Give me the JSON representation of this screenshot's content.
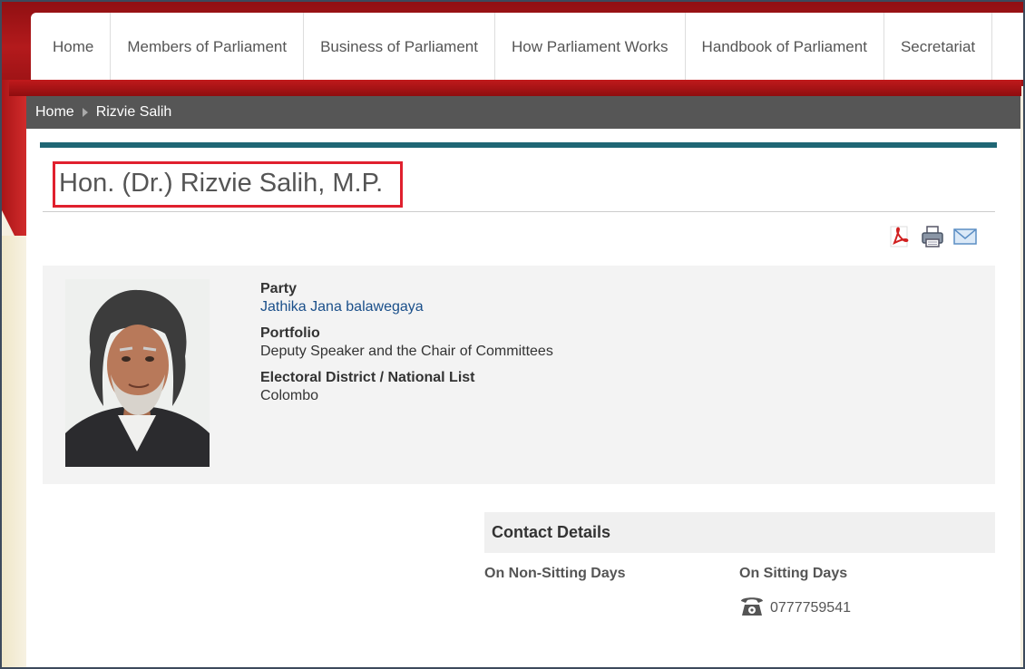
{
  "nav": {
    "items": [
      {
        "label": "Home"
      },
      {
        "label": "Members of Parliament"
      },
      {
        "label": "Business of Parliament"
      },
      {
        "label": "How Parliament Works"
      },
      {
        "label": "Handbook of Parliament"
      },
      {
        "label": "Secretariat"
      }
    ]
  },
  "breadcrumb": {
    "home": "Home",
    "current": "Rizvie Salih"
  },
  "page": {
    "title": "Hon. (Dr.) Rizvie Salih, M.P."
  },
  "tools": [
    {
      "icon": "pdf-icon"
    },
    {
      "icon": "print-icon"
    },
    {
      "icon": "email-icon"
    }
  ],
  "profile": {
    "party_label": "Party",
    "party_value": "Jathika Jana balawegaya",
    "portfolio_label": "Portfolio",
    "portfolio_value": "Deputy Speaker and the Chair of Committees",
    "district_label": "Electoral District / National List",
    "district_value": "Colombo"
  },
  "contact": {
    "heading": "Contact Details",
    "non_sitting_label": "On Non-Sitting Days",
    "sitting_label": "On Sitting Days",
    "phone": "0777759541"
  },
  "colors": {
    "accent_teal": "#1f6674",
    "brand_red": "#b31a1c",
    "highlight_red": "#e0202e"
  }
}
